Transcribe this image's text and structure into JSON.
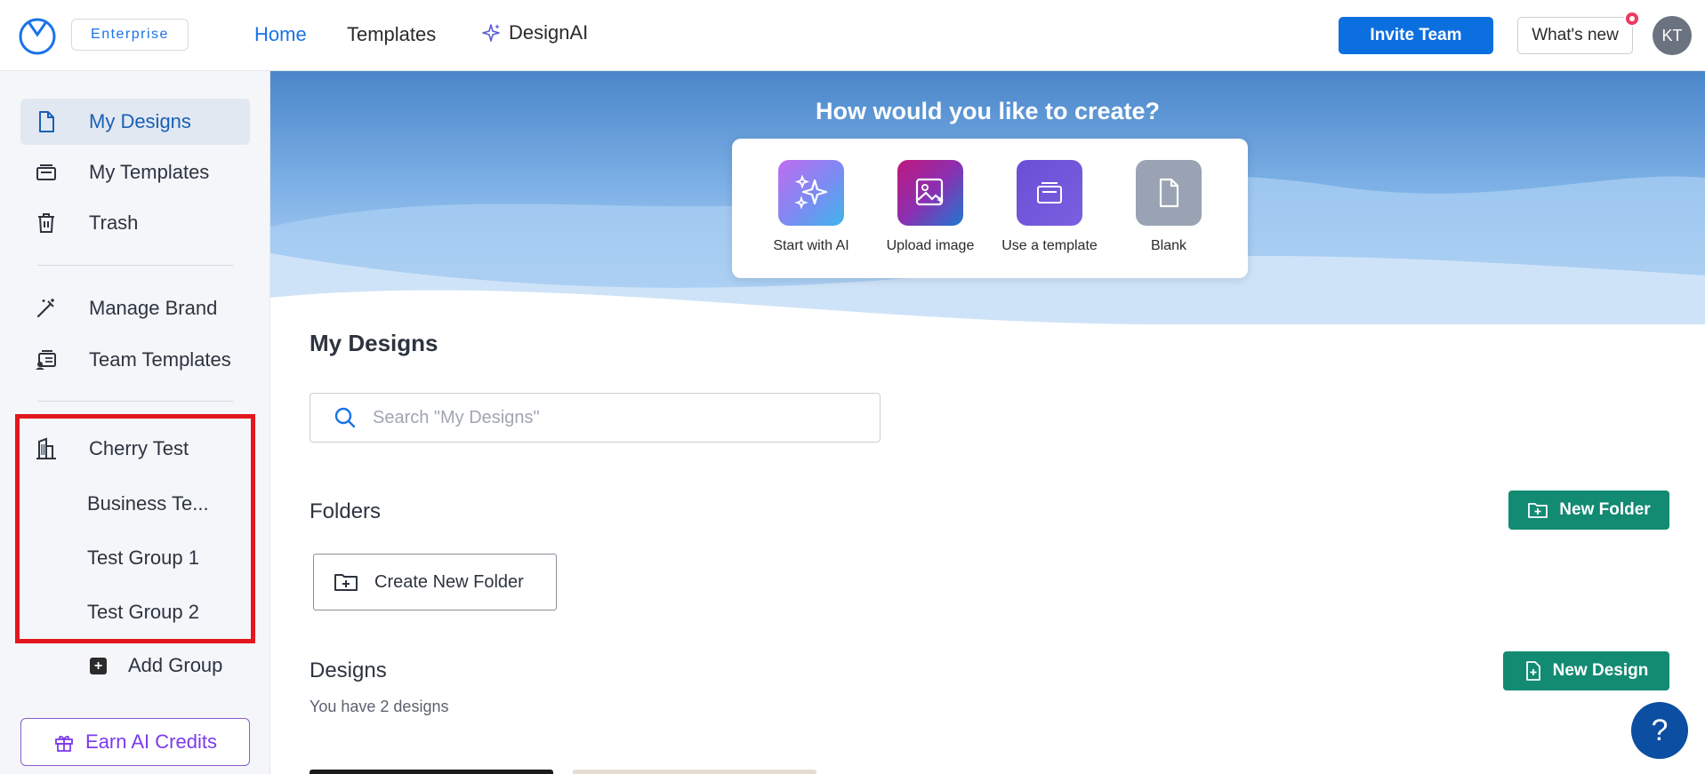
{
  "header": {
    "plan_badge": "Enterprise",
    "nav": [
      {
        "label": "Home",
        "active": true
      },
      {
        "label": "Templates"
      },
      {
        "label": "DesignAI"
      }
    ],
    "invite_label": "Invite Team",
    "whats_new_label": "What's new",
    "avatar_initials": "KT"
  },
  "sidebar": {
    "items": [
      {
        "label": "My Designs",
        "icon": "document-icon",
        "active": true
      },
      {
        "label": "My Templates",
        "icon": "templates-icon"
      },
      {
        "label": "Trash",
        "icon": "trash-icon"
      },
      {
        "label": "Manage Brand",
        "icon": "magic-wand-icon"
      },
      {
        "label": "Team Templates",
        "icon": "team-templates-icon"
      }
    ],
    "workspace": {
      "label": "Cherry Test",
      "icon": "building-icon"
    },
    "groups": [
      "Business Te...",
      "Test Group 1",
      "Test Group 2"
    ],
    "add_group_label": "Add Group",
    "earn_credits_label": "Earn AI Credits"
  },
  "hero": {
    "title": "How would you like to create?",
    "options": [
      {
        "label": "Start with AI",
        "icon": "sparkles-icon"
      },
      {
        "label": "Upload image",
        "icon": "image-upload-icon"
      },
      {
        "label": "Use a template",
        "icon": "template-icon"
      },
      {
        "label": "Blank",
        "icon": "blank-page-icon"
      }
    ]
  },
  "main": {
    "title": "My Designs",
    "search_placeholder": "Search \"My Designs\"",
    "folders_title": "Folders",
    "new_folder_label": "New Folder",
    "create_folder_label": "Create New Folder",
    "designs_title": "Designs",
    "new_design_label": "New Design",
    "designs_count_text": "You have 2 designs"
  },
  "help_label": "?",
  "colors": {
    "primary_blue": "#0c6fe0",
    "green": "#138a72",
    "purple": "#7c3aed",
    "highlight_red": "#e3171e"
  }
}
